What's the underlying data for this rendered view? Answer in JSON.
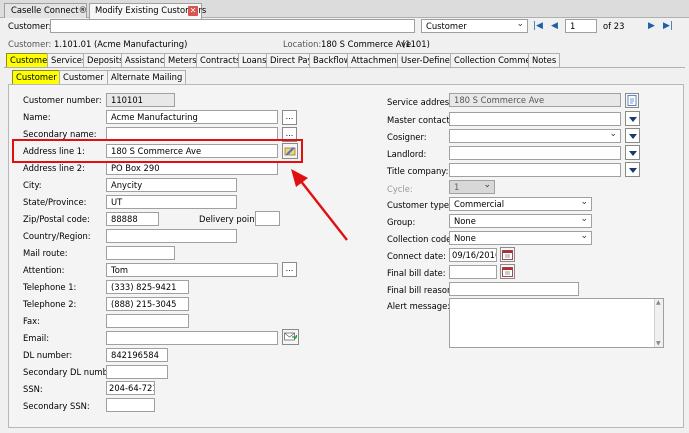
{
  "window_tabs": [
    "Caselle Connect®",
    "Modify Existing Customers"
  ],
  "search": {
    "label": "Customer:",
    "value": "",
    "type_select": "Customer",
    "record_number": "1",
    "record_total": "of 23"
  },
  "header": {
    "customer_label": "Customer:",
    "customer_value": "1.101.01",
    "customer_name": "(Acme Manufacturing)",
    "location_label": "Location:",
    "location_value": "180 S Commerce Ave",
    "location_code": "(1101)"
  },
  "main_tabs": [
    "Customer",
    "Services",
    "Deposits",
    "Assistance",
    "Meters",
    "Contracts",
    "Loans",
    "Direct Pay",
    "Backflow",
    "Attachments",
    "User-Defined",
    "Collection Comments",
    "Notes"
  ],
  "sub_tabs": [
    "Customer 1",
    "Customer 2",
    "Alternate Mailing"
  ],
  "left_fields": [
    {
      "label": "Customer number:",
      "value": "110101"
    },
    {
      "label": "Name:",
      "value": "Acme Manufacturing"
    },
    {
      "label": "Secondary name:",
      "value": ""
    },
    {
      "label": "Address line 1:",
      "value": "180 S Commerce Ave"
    },
    {
      "label": "Address line 2:",
      "value": "PO Box 290"
    },
    {
      "label": "City:",
      "value": "Anycity"
    },
    {
      "label": "State/Province:",
      "value": "UT"
    },
    {
      "label": "Zip/Postal code:",
      "value": "88888"
    },
    {
      "label": "Country/Region:",
      "value": ""
    },
    {
      "label": "Mail route:",
      "value": ""
    },
    {
      "label": "Attention:",
      "value": "Tom"
    },
    {
      "label": "Telephone 1:",
      "value": "(333) 825-9421"
    },
    {
      "label": "Telephone 2:",
      "value": "(888) 215-3045"
    },
    {
      "label": "Fax:",
      "value": ""
    },
    {
      "label": "Email:",
      "value": ""
    },
    {
      "label": "DL number:",
      "value": "842196584"
    },
    {
      "label": "Secondary DL number:",
      "value": ""
    },
    {
      "label": "SSN:",
      "value": "204-64-7219"
    },
    {
      "label": "Secondary SSN:",
      "value": ""
    }
  ],
  "delivery_point": {
    "label": "Delivery point:",
    "value": ""
  },
  "right_fields": {
    "service_address": {
      "label": "Service address:",
      "value": "180 S Commerce Ave"
    },
    "master_contact": {
      "label": "Master contact:",
      "value": ""
    },
    "cosigner": {
      "label": "Cosigner:",
      "value": ""
    },
    "landlord": {
      "label": "Landlord:",
      "value": ""
    },
    "title_company": {
      "label": "Title company:",
      "value": ""
    },
    "cycle": {
      "label": "Cycle:",
      "value": "1"
    },
    "customer_type": {
      "label": "Customer type:",
      "value": "Commercial"
    },
    "group": {
      "label": "Group:",
      "value": "None"
    },
    "collection_code": {
      "label": "Collection code:",
      "value": "None"
    },
    "connect_date": {
      "label": "Connect date:",
      "value": "09/16/2016"
    },
    "final_bill_date": {
      "label": "Final bill date:",
      "value": ""
    },
    "final_bill_reason": {
      "label": "Final bill reason:",
      "value": ""
    },
    "alert_message": {
      "label": "Alert message:",
      "value": ""
    }
  },
  "ellipsis": "...",
  "annotation": {
    "highlight_color": "#e01010",
    "arrow_color": "#e01010"
  },
  "icons": [
    "close-icon",
    "first-record-icon",
    "prev-record-icon",
    "next-record-icon",
    "last-record-icon",
    "address-lookup-icon",
    "email-icon",
    "calendar-icon",
    "document-icon"
  ]
}
